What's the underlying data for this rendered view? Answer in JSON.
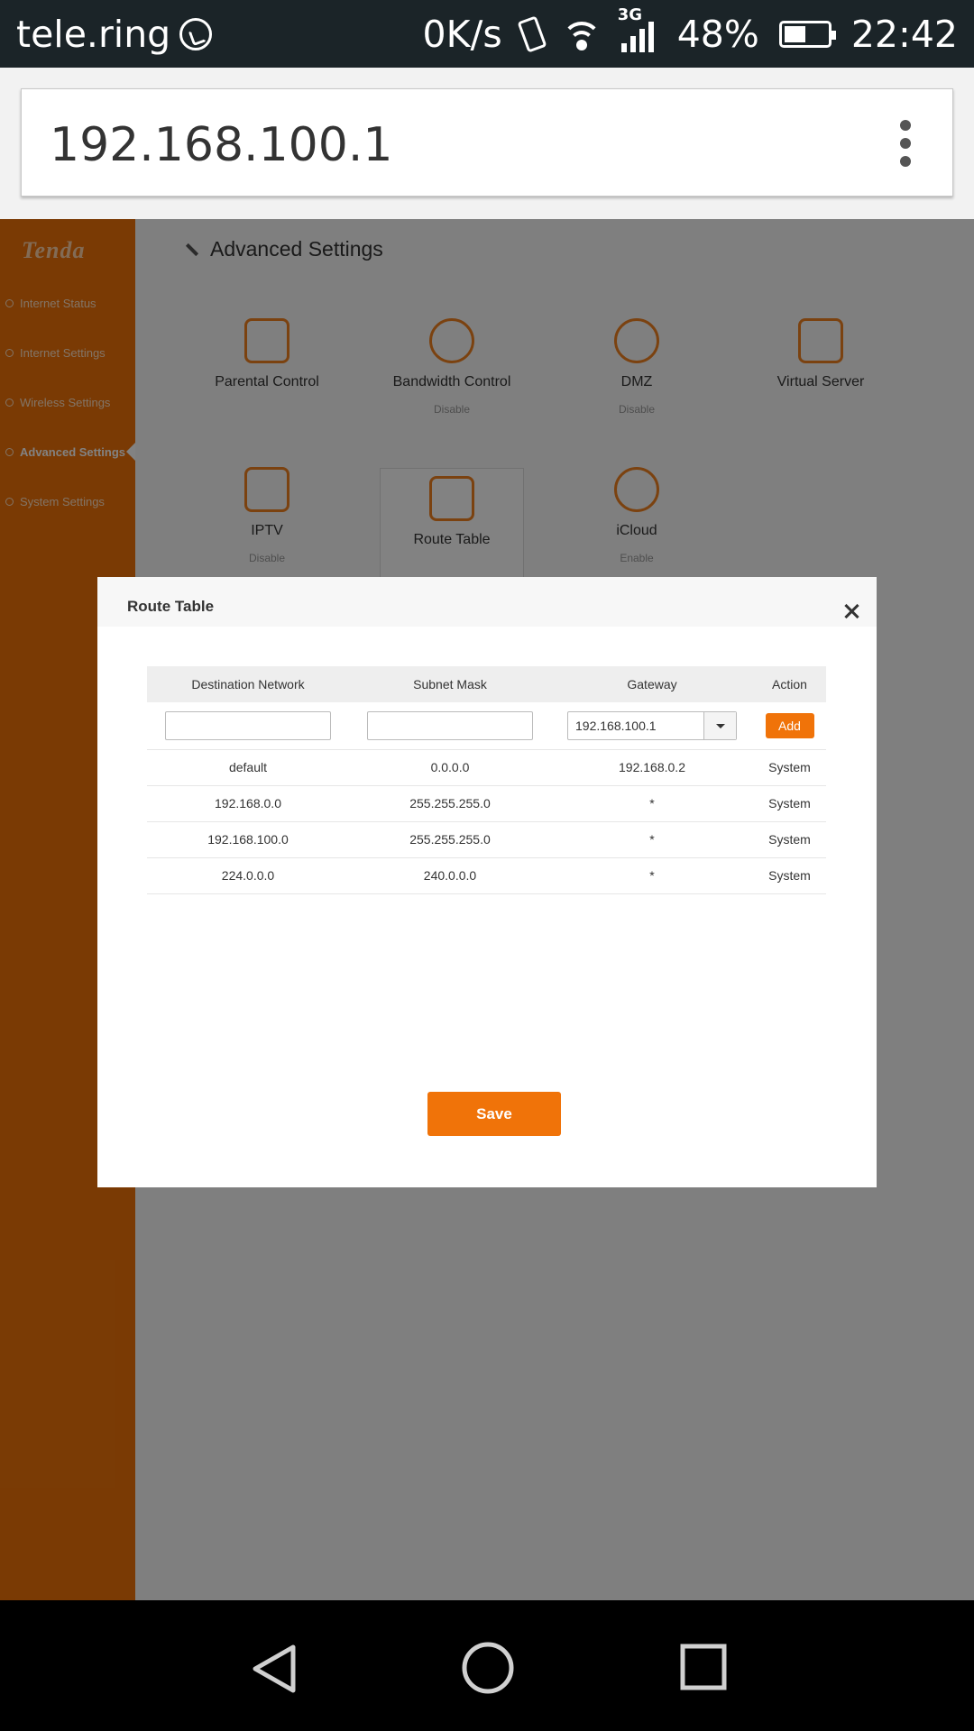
{
  "status_bar": {
    "carrier": "tele.ring",
    "speed": "0K/s",
    "network": "3G",
    "battery": "48%",
    "time": "22:42"
  },
  "browser": {
    "url": "192.168.100.1"
  },
  "sidebar": {
    "logo": "Tenda",
    "items": [
      {
        "label": "Internet Status"
      },
      {
        "label": "Internet Settings"
      },
      {
        "label": "Wireless Settings"
      },
      {
        "label": "Advanced Settings"
      },
      {
        "label": "System Settings"
      }
    ]
  },
  "main": {
    "title": "Advanced Settings",
    "tiles": [
      {
        "name": "Parental Control",
        "status": ""
      },
      {
        "name": "Bandwidth Control",
        "status": "Disable"
      },
      {
        "name": "DMZ",
        "status": "Disable"
      },
      {
        "name": "Virtual Server",
        "status": ""
      },
      {
        "name": "IPTV",
        "status": "Disable"
      },
      {
        "name": "Route Table",
        "status": ""
      },
      {
        "name": "iCloud",
        "status": "Enable"
      }
    ]
  },
  "modal": {
    "title": "Route Table",
    "columns": [
      "Destination Network",
      "Subnet Mask",
      "Gateway",
      "Action"
    ],
    "gateway_select": "192.168.100.1",
    "add_label": "Add",
    "rows": [
      {
        "dest": "default",
        "mask": "0.0.0.0",
        "gateway": "192.168.0.2",
        "action": "System"
      },
      {
        "dest": "192.168.0.0",
        "mask": "255.255.255.0",
        "gateway": "*",
        "action": "System"
      },
      {
        "dest": "192.168.100.0",
        "mask": "255.255.255.0",
        "gateway": "*",
        "action": "System"
      },
      {
        "dest": "224.0.0.0",
        "mask": "240.0.0.0",
        "gateway": "*",
        "action": "System"
      }
    ],
    "save_label": "Save"
  },
  "colors": {
    "accent": "#f07309",
    "statusbar": "#1b2428"
  }
}
